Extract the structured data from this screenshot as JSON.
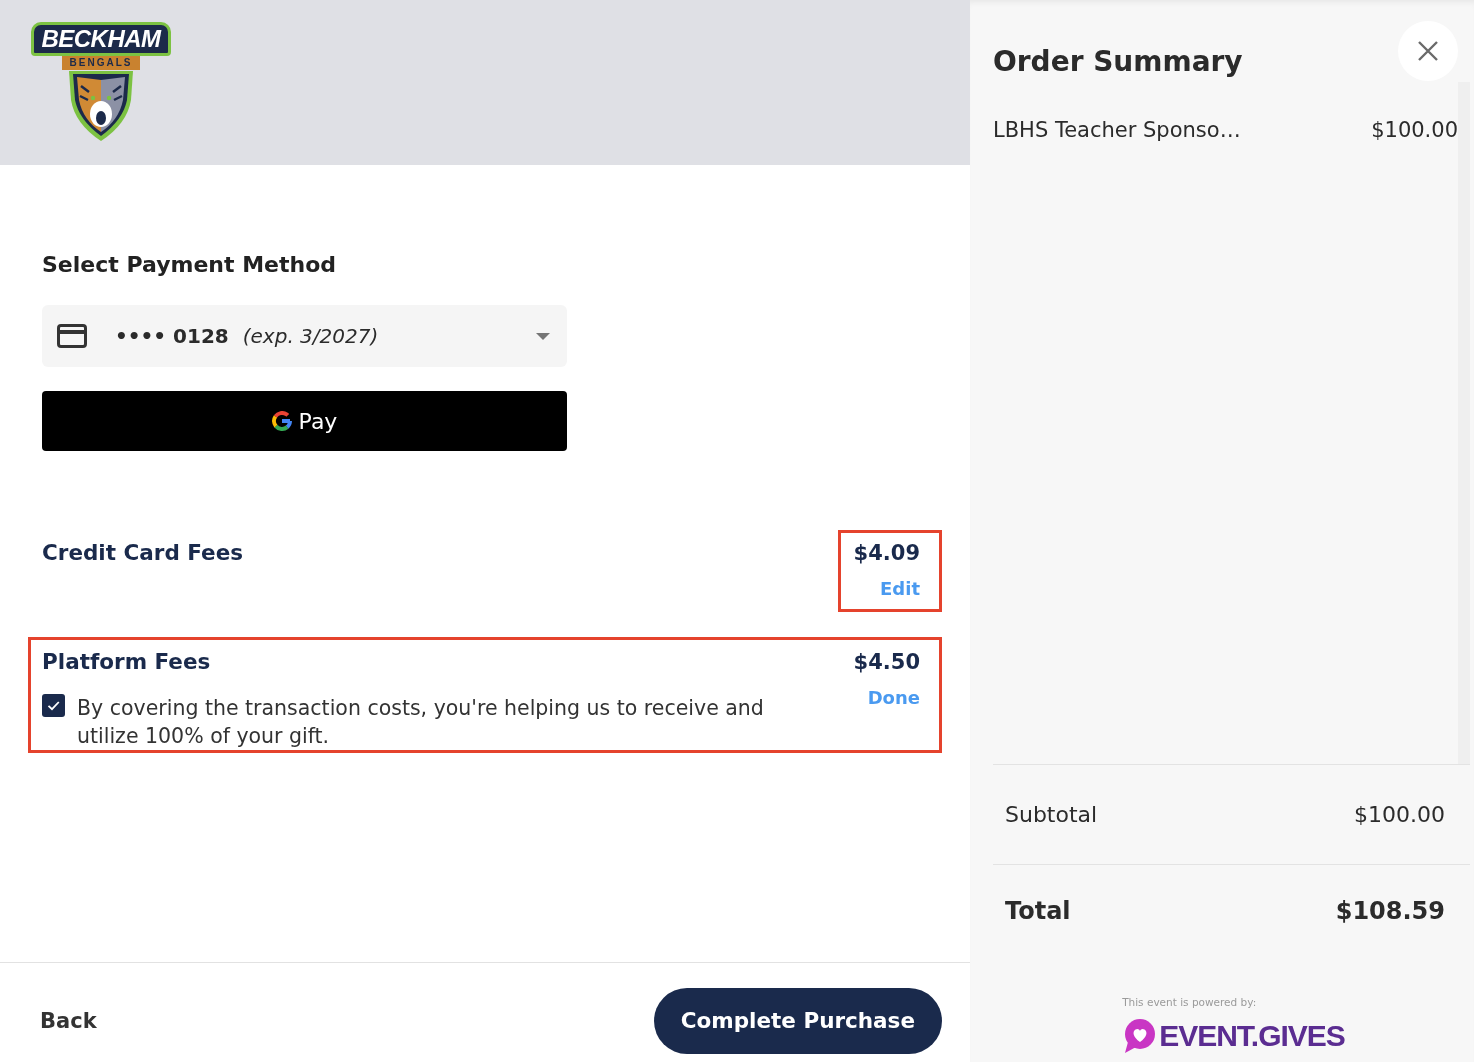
{
  "header": {
    "logo": {
      "wordmark": "BECKHAM",
      "subtitle": "BENGALS"
    }
  },
  "payment": {
    "title": "Select Payment Method",
    "selected_card": {
      "number": "•••• 0128",
      "expiry": "(exp. 3/2027)"
    },
    "wallet_button": {
      "label": "Pay"
    }
  },
  "fees": [
    {
      "label": "Credit Card Fees",
      "amount": "$4.09",
      "action": "Edit",
      "amount_highlighted": true,
      "row_highlighted": false
    },
    {
      "label": "Platform Fees",
      "amount": "$4.50",
      "action": "Done",
      "amount_highlighted": false,
      "row_highlighted": true,
      "cover_costs": {
        "checked": true,
        "text": "By covering the transaction costs, you're helping us to receive and utilize 100% of your gift."
      }
    }
  ],
  "footer": {
    "back": "Back",
    "submit": "Complete Purchase"
  },
  "order_summary": {
    "title": "Order Summary",
    "items": [
      {
        "name": "LBHS Teacher Sponso…",
        "price": "$100.00"
      }
    ],
    "subtotal": {
      "label": "Subtotal",
      "amount": "$100.00"
    },
    "total": {
      "label": "Total",
      "amount": "$108.59"
    },
    "powered_by": {
      "caption": "This event is powered by:",
      "brand": "EVENT.GIVES"
    }
  }
}
